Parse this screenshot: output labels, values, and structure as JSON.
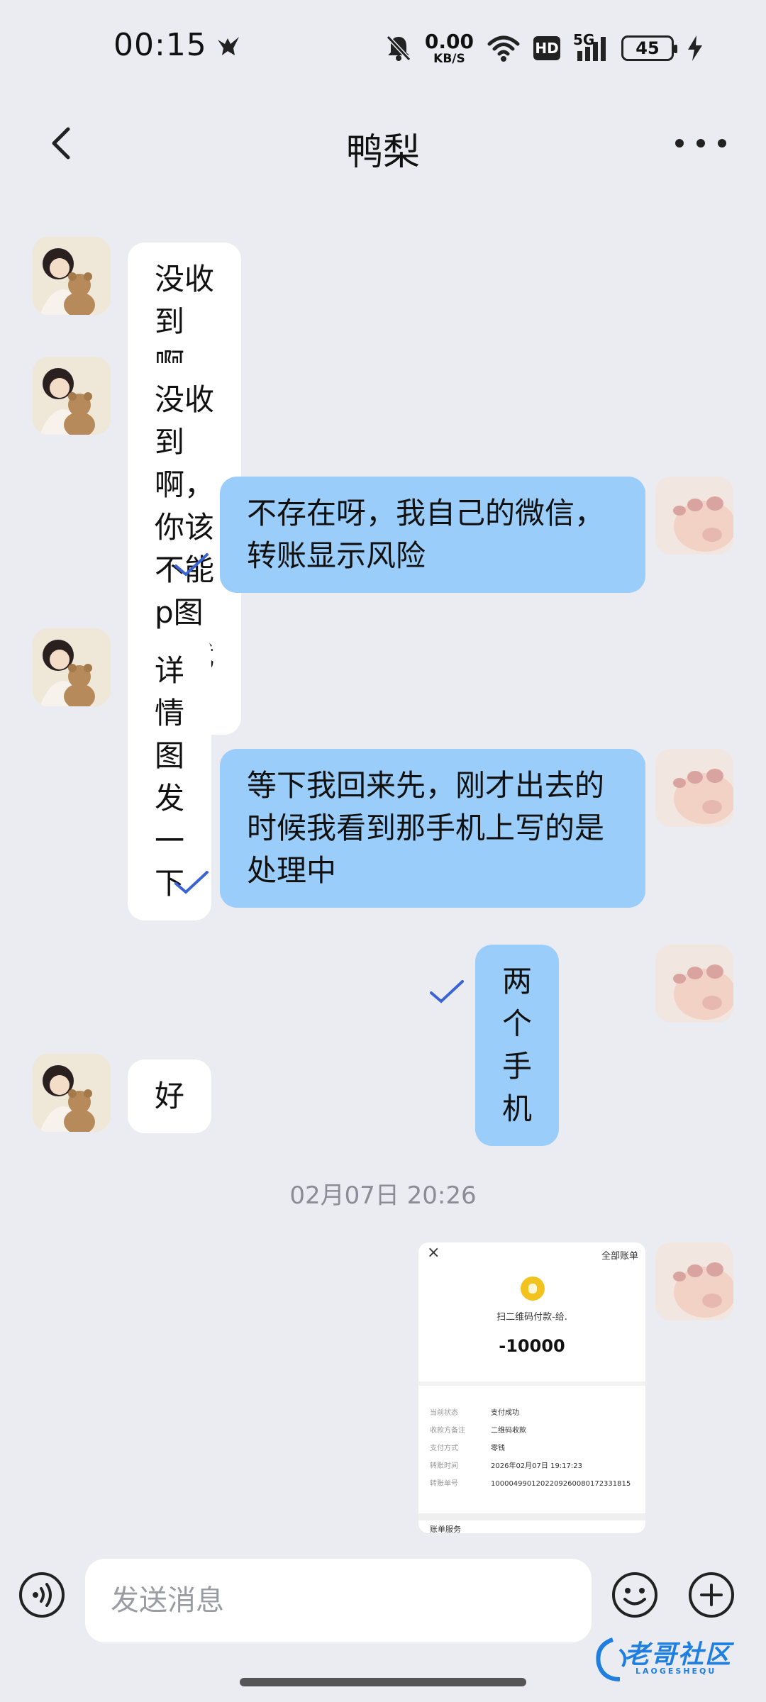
{
  "status_bar": {
    "time": "00:15",
    "net_speed": "0.00",
    "net_unit": "KB/S",
    "hd": "HD",
    "signal": "5G",
    "battery": "45"
  },
  "nav": {
    "title": "鸭梨"
  },
  "messages": [
    {
      "side": "in",
      "text": "没收到啊，你该不能p图骗我吧"
    },
    {
      "side": "in",
      "text": "没收到啊，你该不能p图骗我吧"
    },
    {
      "side": "out",
      "lines": [
        "不存在呀，我自己的微信，",
        "转账显示风险"
      ],
      "read": true
    },
    {
      "side": "in",
      "text": "详情图发一下"
    },
    {
      "side": "out",
      "lines": [
        "等下我回来先，刚才出去的",
        "时候我看到那手机上写的是",
        "处理中"
      ],
      "read": true
    },
    {
      "side": "out",
      "text": "两个手机",
      "read": true
    },
    {
      "side": "in",
      "text": "好"
    }
  ],
  "timestamp": "02月07日 20:26",
  "image_message": {
    "close": "×",
    "all_bills": "全部账单",
    "title": "扫二维码付款-给.",
    "amount": "-10000",
    "rows": [
      {
        "k": "当前状态",
        "v": "支付成功"
      },
      {
        "k": "收款方备注",
        "v": "二维码收款"
      },
      {
        "k": "支付方式",
        "v": "零钱"
      },
      {
        "k": "转账时间",
        "v": "2026年02月07日 19:17:23"
      },
      {
        "k": "转账单号",
        "v": "1000049901202209260080172331815"
      }
    ],
    "footer": "账单服务"
  },
  "input": {
    "placeholder": "发送消息"
  },
  "watermark": {
    "text": "老哥社区",
    "sub": "LAOGESHEQU"
  },
  "colors": {
    "background": "#ebecf1",
    "incoming_bubble": "#ffffff",
    "outgoing_bubble": "#9bcdfa",
    "read_check": "#3a63d6"
  }
}
